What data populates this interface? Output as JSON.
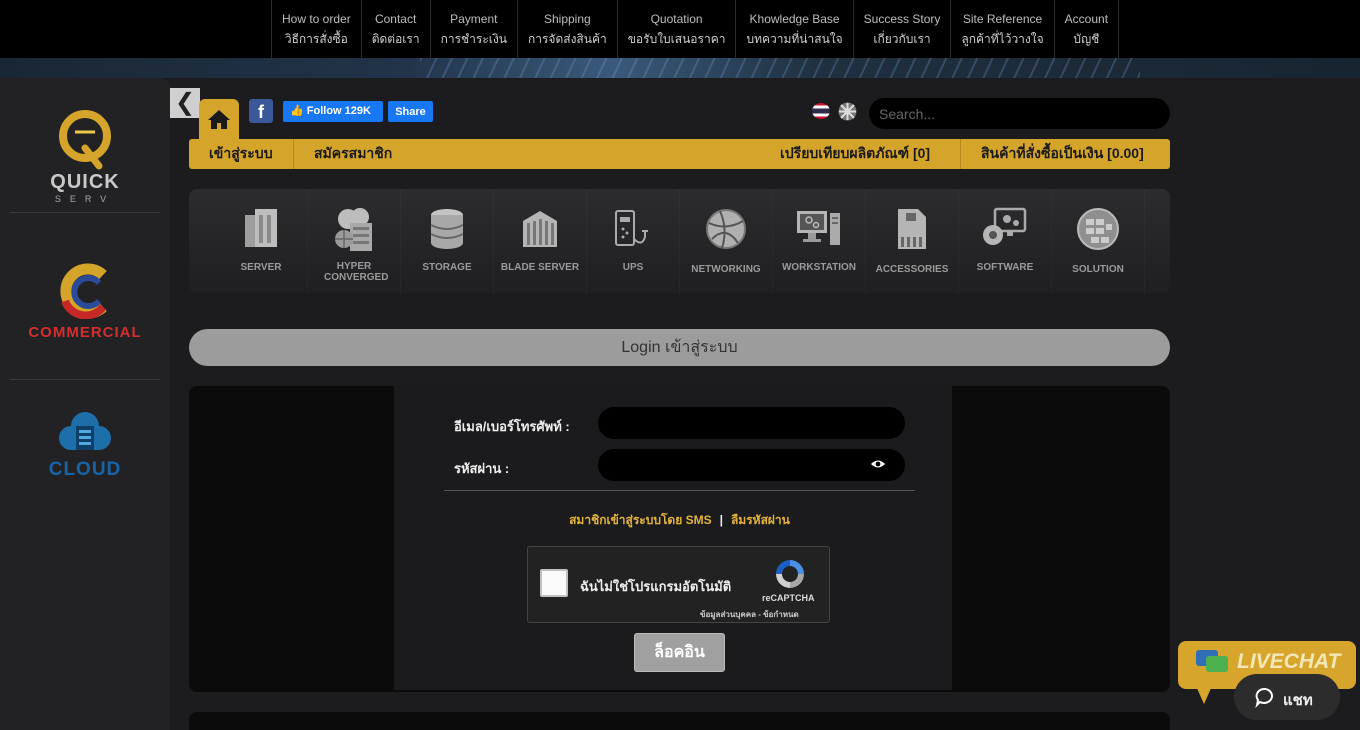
{
  "topnav": {
    "items": [
      {
        "en": "How to order",
        "th": "วิธีการสั่งซื้อ"
      },
      {
        "en": "Contact",
        "th": "ติดต่อเรา"
      },
      {
        "en": "Payment",
        "th": "การชำระเงิน"
      },
      {
        "en": "Shipping",
        "th": "การจัดส่งสินค้า"
      },
      {
        "en": "Quotation",
        "th": "ขอรับใบเสนอราคา"
      },
      {
        "en": "Khowledge Base",
        "th": "บทความที่น่าสนใจ"
      },
      {
        "en": "Success Story",
        "th": "เกี่ยวกับเรา"
      },
      {
        "en": "Site Reference",
        "th": "ลูกค้าที่ไว้วางใจ"
      },
      {
        "en": "Account",
        "th": "บัญชี"
      }
    ]
  },
  "sidebar": {
    "brands": [
      {
        "name": "QUICK",
        "sub": "SERV"
      },
      {
        "name": "COMMERCIAL"
      },
      {
        "name": "CLOUD"
      }
    ]
  },
  "header": {
    "facebook_follow": "Follow 129K",
    "facebook_share": "Share",
    "search_placeholder": "Search..."
  },
  "gold_bar": {
    "login": "เข้าสู่ระบบ",
    "register": "สมัครสมาชิก",
    "compare": "เปรียบเทียบผลิตภัณฑ์ [0]",
    "cart": "สินค้าที่สั่งซื้อเป็นเงิน [0.00]"
  },
  "categories": [
    {
      "label": "SERVER",
      "icon": "server-icon"
    },
    {
      "label": "HYPER CONVERGED",
      "icon": "hyper-converged-icon"
    },
    {
      "label": "STORAGE",
      "icon": "storage-icon"
    },
    {
      "label": "BLADE SERVER",
      "icon": "blade-server-icon"
    },
    {
      "label": "UPS",
      "icon": "ups-icon"
    },
    {
      "label": "NETWORKING",
      "icon": "networking-icon"
    },
    {
      "label": "WORKSTATION",
      "icon": "workstation-icon"
    },
    {
      "label": "ACCESSORIES",
      "icon": "accessories-icon"
    },
    {
      "label": "SOFTWARE",
      "icon": "software-icon"
    },
    {
      "label": "SOLUTION",
      "icon": "solution-icon"
    }
  ],
  "login": {
    "title": "Login เข้าสู่ระบบ",
    "email_label": "อีเมล/เบอร์โทรศัพท์ :",
    "password_label": "รหัสผ่าน :",
    "sms_link": "สมาชิกเข้าสู่ระบบโดย SMS",
    "separator": "|",
    "forgot_link": "ลืมรหัสผ่าน",
    "captcha_label": "ฉันไม่ใช่โปรแกรมอัตโนมัติ",
    "captcha_brand": "reCAPTCHA",
    "captcha_terms": "ข้อมูลส่วนบุคคล - ข้อกำหนด",
    "submit": "ล็อคอิน"
  },
  "livechat": {
    "banner": "LIVECHAT",
    "button": "แชท"
  },
  "colors": {
    "gold": "#d4a52a",
    "facebook": "#1877f2",
    "background": "#1c1c1e"
  }
}
